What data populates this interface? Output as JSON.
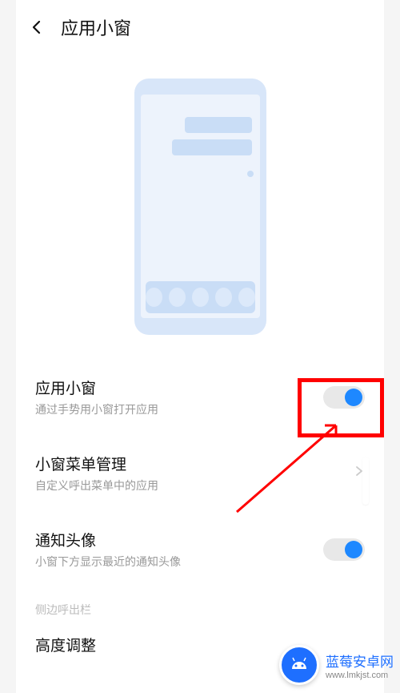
{
  "header": {
    "title": "应用小窗"
  },
  "settings": {
    "app_window": {
      "title": "应用小窗",
      "desc": "通过手势用小窗打开应用",
      "on": true
    },
    "menu_manage": {
      "title": "小窗菜单管理",
      "desc": "自定义呼出菜单中的应用"
    },
    "notif_avatar": {
      "title": "通知头像",
      "desc": "小窗下方显示最近的通知头像",
      "on": true
    }
  },
  "section": {
    "side_out": "侧边呼出栏",
    "height_adjust": "高度调整"
  },
  "watermark": {
    "title": "蓝莓安卓网",
    "url": "www.lmkjst.com"
  }
}
